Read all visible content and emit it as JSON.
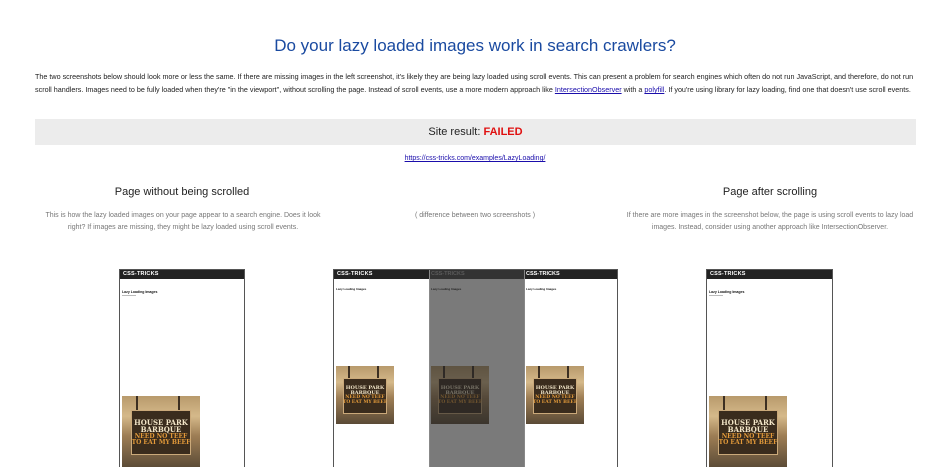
{
  "page": {
    "title": "Do your lazy loaded images work in search crawlers?",
    "intro": {
      "text_before_link1": "The two screenshots below should look more or less the same. If there are missing images in the left screenshot, it's likely they are being lazy loaded using scroll events. This can present a problem for search engines which often do not run JavaScript, and therefore, do not run scroll handlers. Images need to be fully loaded when they're \"in the viewport\", without scrolling the page. Instead of scroll events, use a more modern approach like ",
      "link1": "IntersectionObserver",
      "text_between_links": " with a ",
      "link2": "polyfill",
      "text_after_link2": ". If you're using library for lazy loading, find one that doesn't use scroll events."
    },
    "result": {
      "label": "Site result: ",
      "status": "FAILED"
    },
    "url": "https://css-tricks.com/examples/LazyLoading/"
  },
  "columns": {
    "left": {
      "heading": "Page without being scrolled",
      "description": "This is how the lazy loaded images on your page appear to a search engine. Does it look right? If images are missing, they might be lazy loaded using scroll events."
    },
    "middle": {
      "description": "( difference between two screenshots )"
    },
    "right": {
      "heading": "Page after scrolling",
      "description": "If there are more images in the screenshot below, the page is using scroll events to lazy load images. Instead, consider using another approach like IntersectionObserver."
    }
  },
  "screenshot": {
    "site_header": "CSS-TRICKS",
    "page_heading": "Lazy Loading Images",
    "sign": {
      "line1": "HOUSE PARK",
      "line2": "BARBQUE",
      "line3": "NEED NO TEEF",
      "line4": "TO EAT MY BEEF"
    }
  },
  "colors": {
    "title": "#1a4aa0",
    "failed": "#e01010",
    "result_bar_bg": "#ececec",
    "link": "#1a0dab"
  }
}
